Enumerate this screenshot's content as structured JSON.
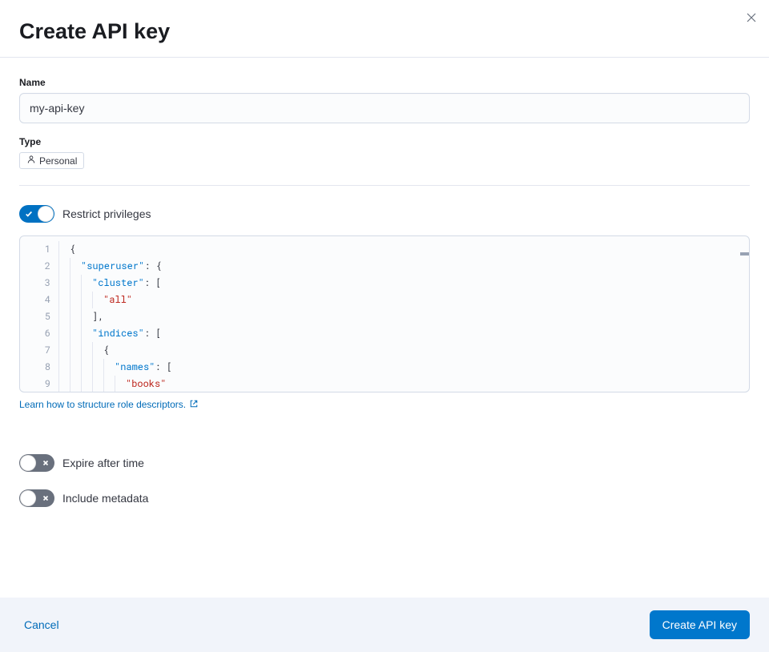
{
  "header": {
    "title": "Create API key"
  },
  "form": {
    "name_label": "Name",
    "name_value": "my-api-key",
    "type_label": "Type",
    "type_value": "Personal"
  },
  "switches": {
    "restrict": "Restrict privileges",
    "expire": "Expire after time",
    "metadata": "Include metadata"
  },
  "code": {
    "line1_punc": "{",
    "line2_key": "\"superuser\"",
    "line2_punc": ": {",
    "line3_key": "\"cluster\"",
    "line3_punc": ": [",
    "line4_str": "\"all\"",
    "line5_punc": "],",
    "line6_key": "\"indices\"",
    "line6_punc": ": [",
    "line7_punc": "{",
    "line8_key": "\"names\"",
    "line8_punc": ": [",
    "line9_str": "\"books\"",
    "gutter": [
      "1",
      "2",
      "3",
      "4",
      "5",
      "6",
      "7",
      "8",
      "9"
    ]
  },
  "help_link": "Learn how to structure role descriptors.",
  "footer": {
    "cancel": "Cancel",
    "submit": "Create API key"
  }
}
